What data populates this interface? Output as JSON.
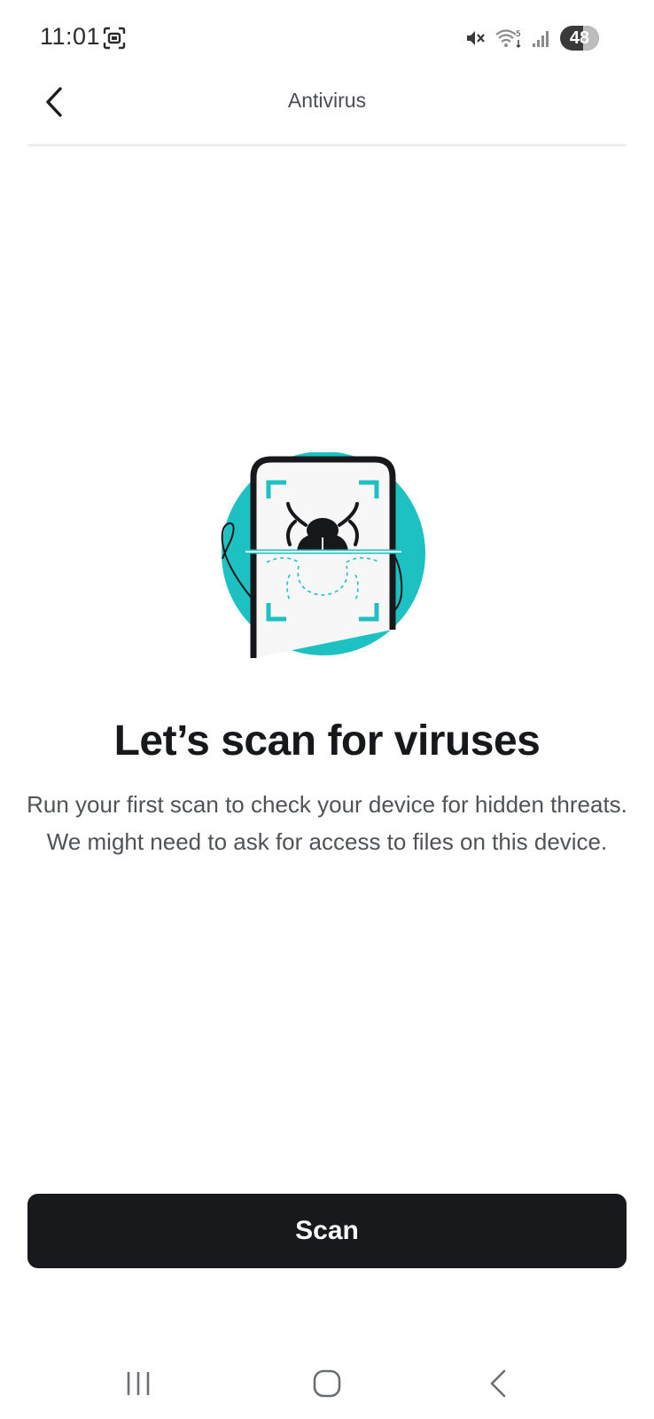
{
  "status_bar": {
    "time": "11:01",
    "battery_level": "48",
    "icons": [
      "screen-record-icon",
      "mute-icon",
      "wifi-icon",
      "signal-icon",
      "battery-icon"
    ]
  },
  "app_bar": {
    "title": "Antivirus",
    "back_icon": "chevron-left-icon"
  },
  "illustration": {
    "name": "bug-scan-illustration",
    "accent_color": "#1ec1c1"
  },
  "content": {
    "headline": "Let’s scan for viruses",
    "description": "Run your first scan to check your device for hidden threats. We might need to ask for access to files on this device."
  },
  "primary_action": {
    "label": "Scan",
    "color": "#17191c"
  },
  "nav_bar": {
    "items": [
      "recent-apps-icon",
      "home-icon",
      "back-icon"
    ]
  }
}
